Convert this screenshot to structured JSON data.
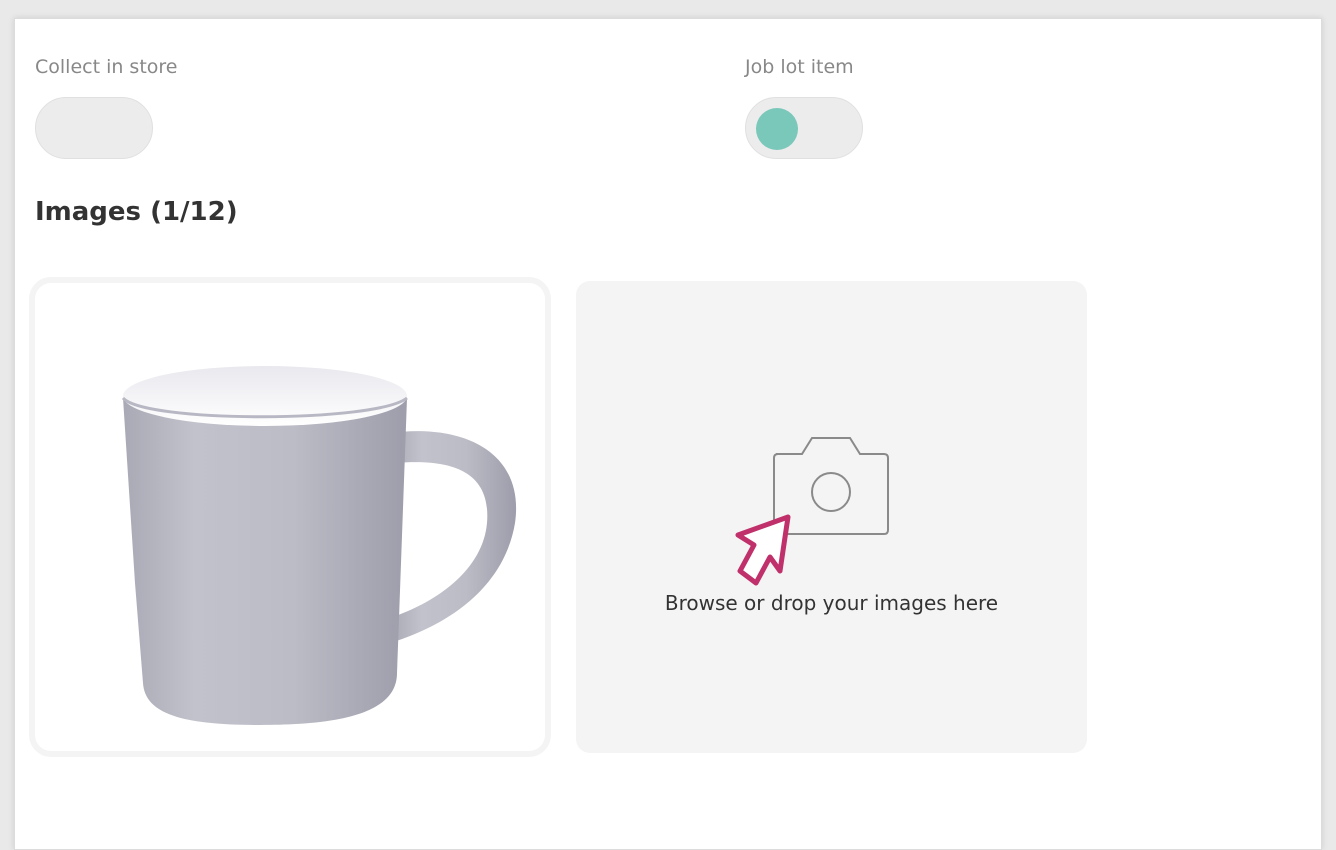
{
  "options": {
    "collect_in_store": {
      "label": "Collect in store",
      "enabled": false
    },
    "job_lot_item": {
      "label": "Job lot item",
      "enabled": true
    }
  },
  "images": {
    "title": "Images (1/12)",
    "dropzone_text": "Browse or drop your images here",
    "thumbnails": [
      {
        "subject": "grey mug"
      }
    ]
  },
  "colors": {
    "toggle_knob": "#7ac8ba",
    "pointer_accent": "#c0306a",
    "dropzone_bg": "#f4f4f4"
  },
  "icons": [
    "camera-icon",
    "pointer-hand-icon"
  ]
}
